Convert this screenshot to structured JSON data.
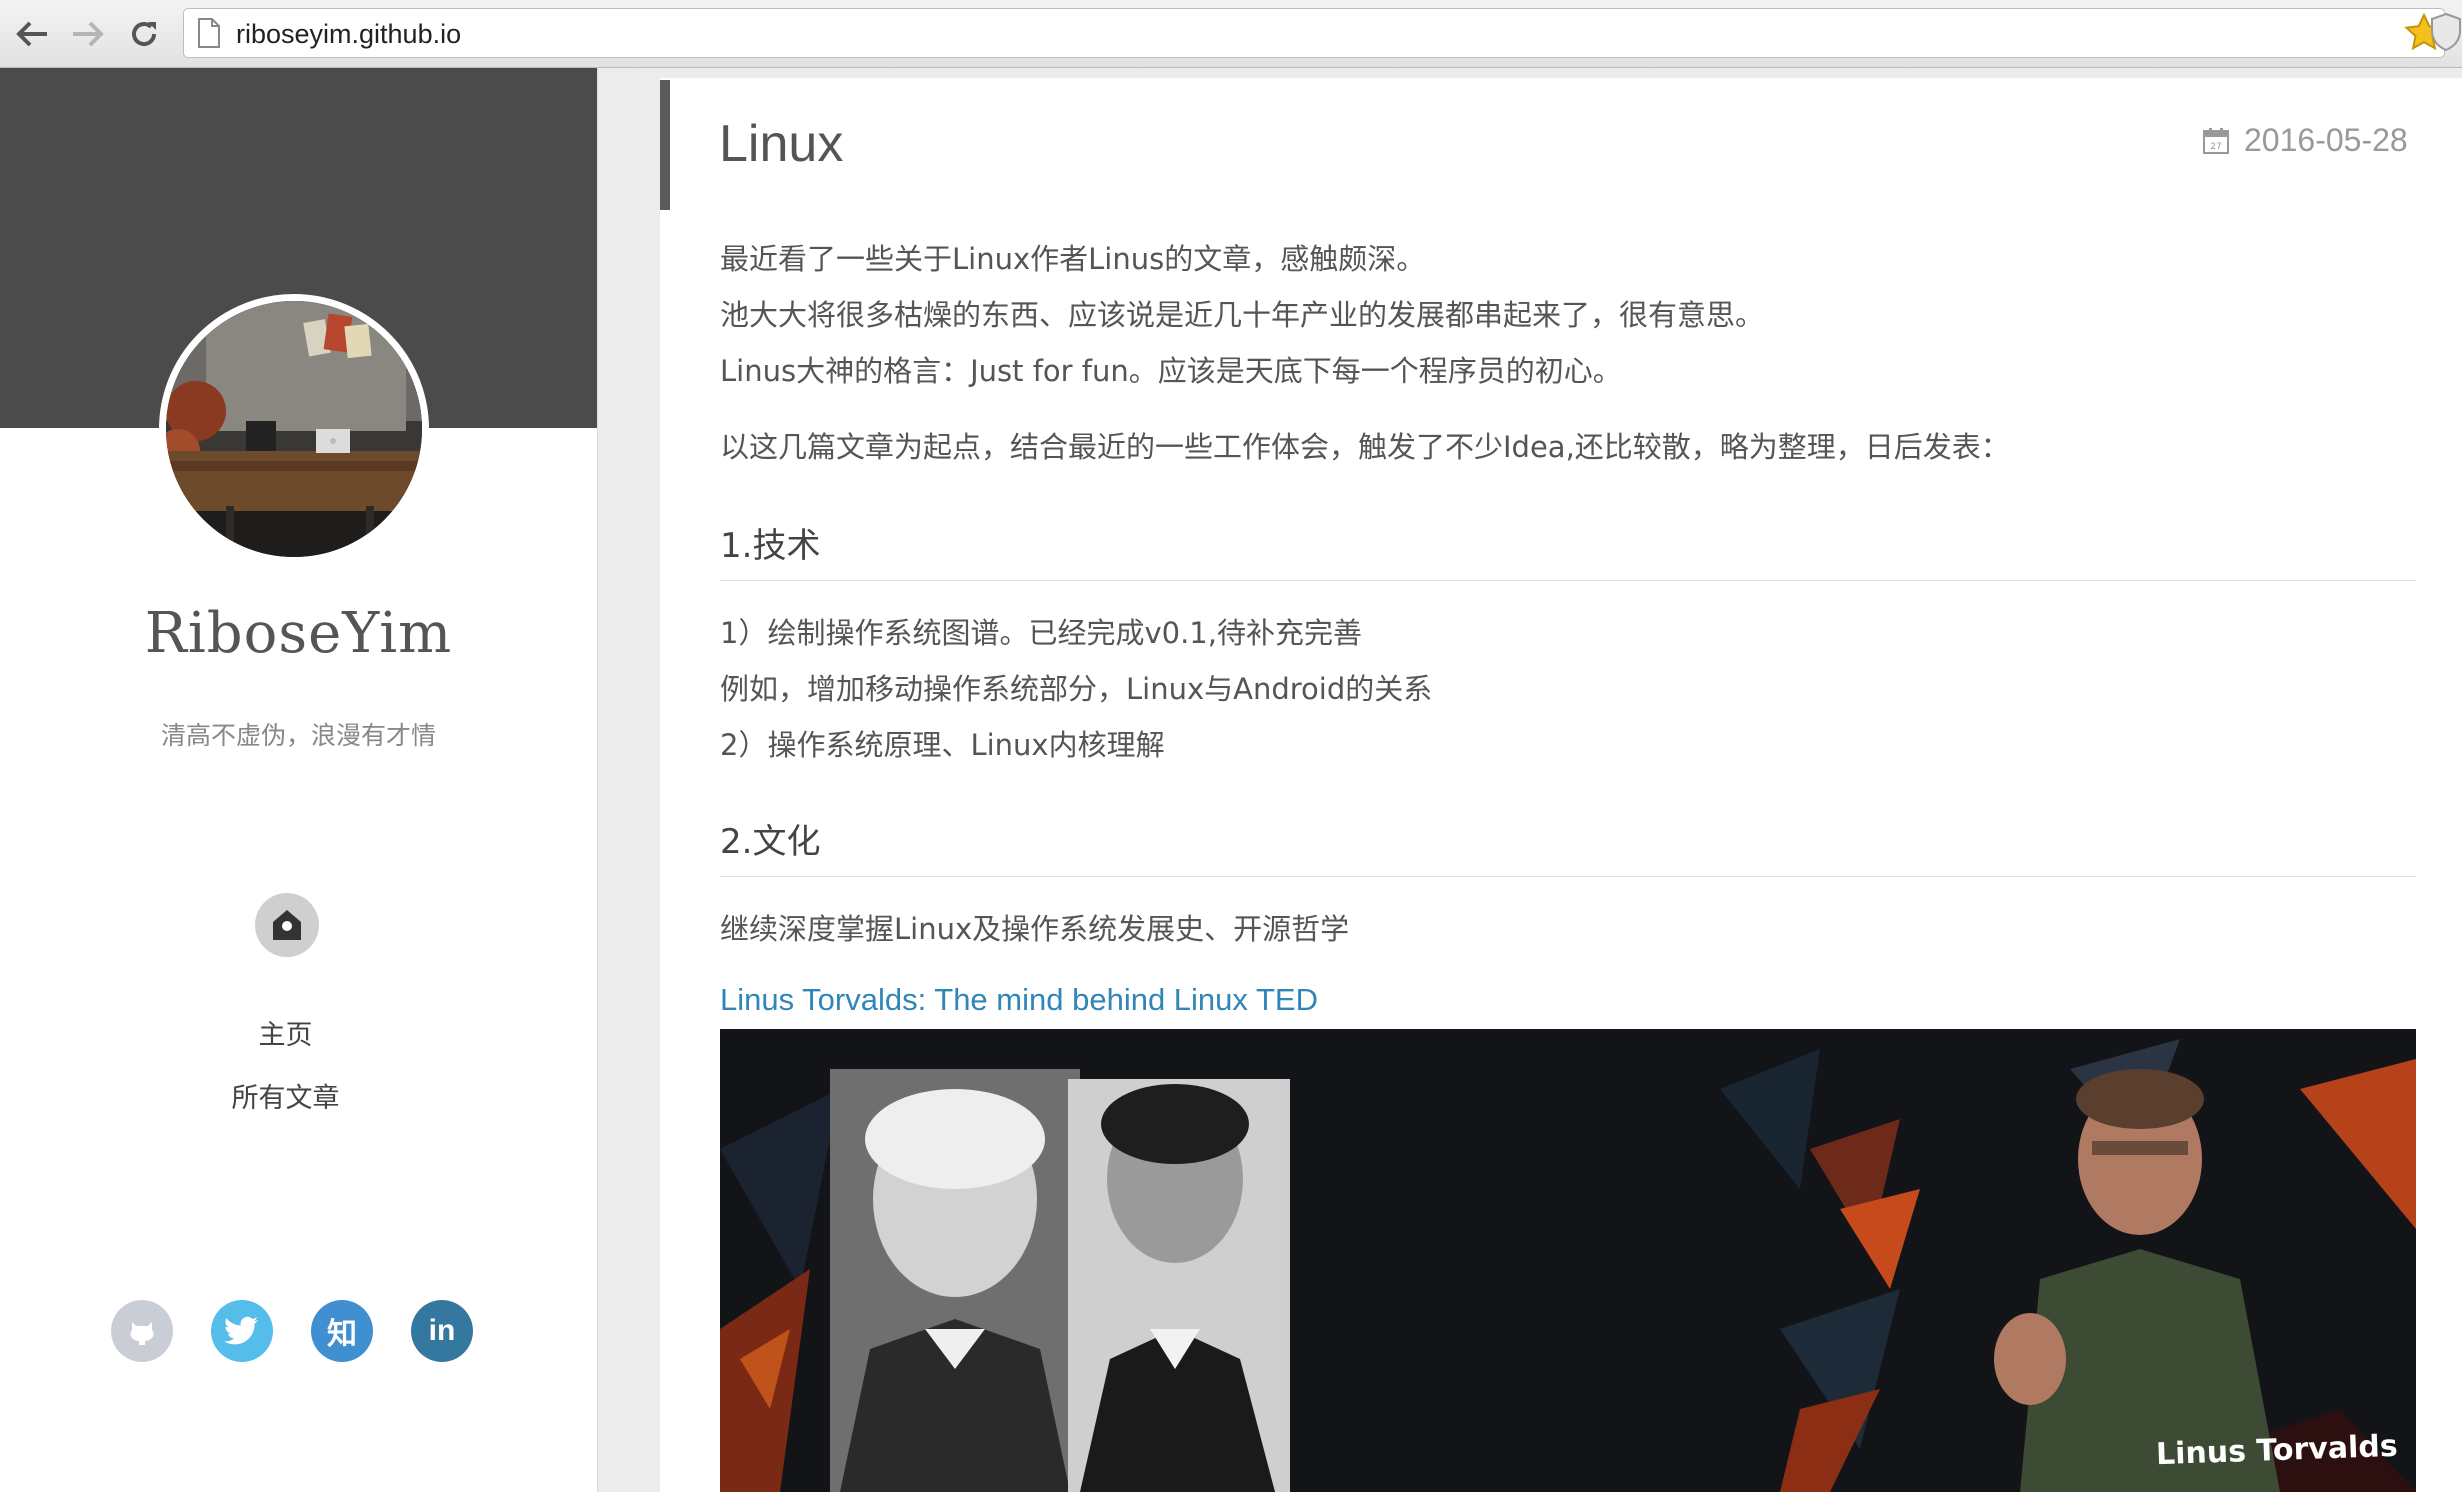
{
  "browser": {
    "url": "riboseyim.github.io"
  },
  "sidebar": {
    "site_name": "RiboseYim",
    "motto": "清高不虚伪，浪漫有才情",
    "nav": [
      {
        "label": "主页"
      },
      {
        "label": "所有文章"
      }
    ],
    "social": [
      {
        "name": "github",
        "color": "#c9cdd6"
      },
      {
        "name": "twitter",
        "color": "#55bdea"
      },
      {
        "name": "zhihu",
        "label": "知",
        "color": "#3f8fd1"
      },
      {
        "name": "linkedin",
        "label": "in",
        "color": "#35789f"
      }
    ]
  },
  "post": {
    "title": "Linux",
    "date": "2016-05-28",
    "intro": [
      "最近看了一些关于Linux作者Linus的文章，感触颇深。",
      "池大大将很多枯燥的东西、应该说是近几十年产业的发展都串起来了，很有意思。",
      "Linus大神的格言：Just for fun。应该是天底下每一个程序员的初心。"
    ],
    "lead": "以这几篇文章为起点，结合最近的一些工作体会，触发了不少Idea,还比较散，略为整理，日后发表：",
    "sections": [
      {
        "heading": "1.技术",
        "lines": [
          "1）绘制操作系统图谱。已经完成v0.1,待补充完善",
          "例如，增加移动操作系统部分，Linux与Android的关系",
          "2）操作系统原理、Linux内核理解"
        ]
      },
      {
        "heading": "2.文化",
        "lines": [
          "继续深度掌握Linux及操作系统发展史、开源哲学"
        ]
      }
    ],
    "link_text": "Linus Torvalds: The mind behind Linux TED",
    "video_caption": "Linus Torvalds"
  },
  "colors": {
    "banner": "#4b4b4b",
    "link": "#2f86b7",
    "title_accent": "#5b5b5b"
  }
}
